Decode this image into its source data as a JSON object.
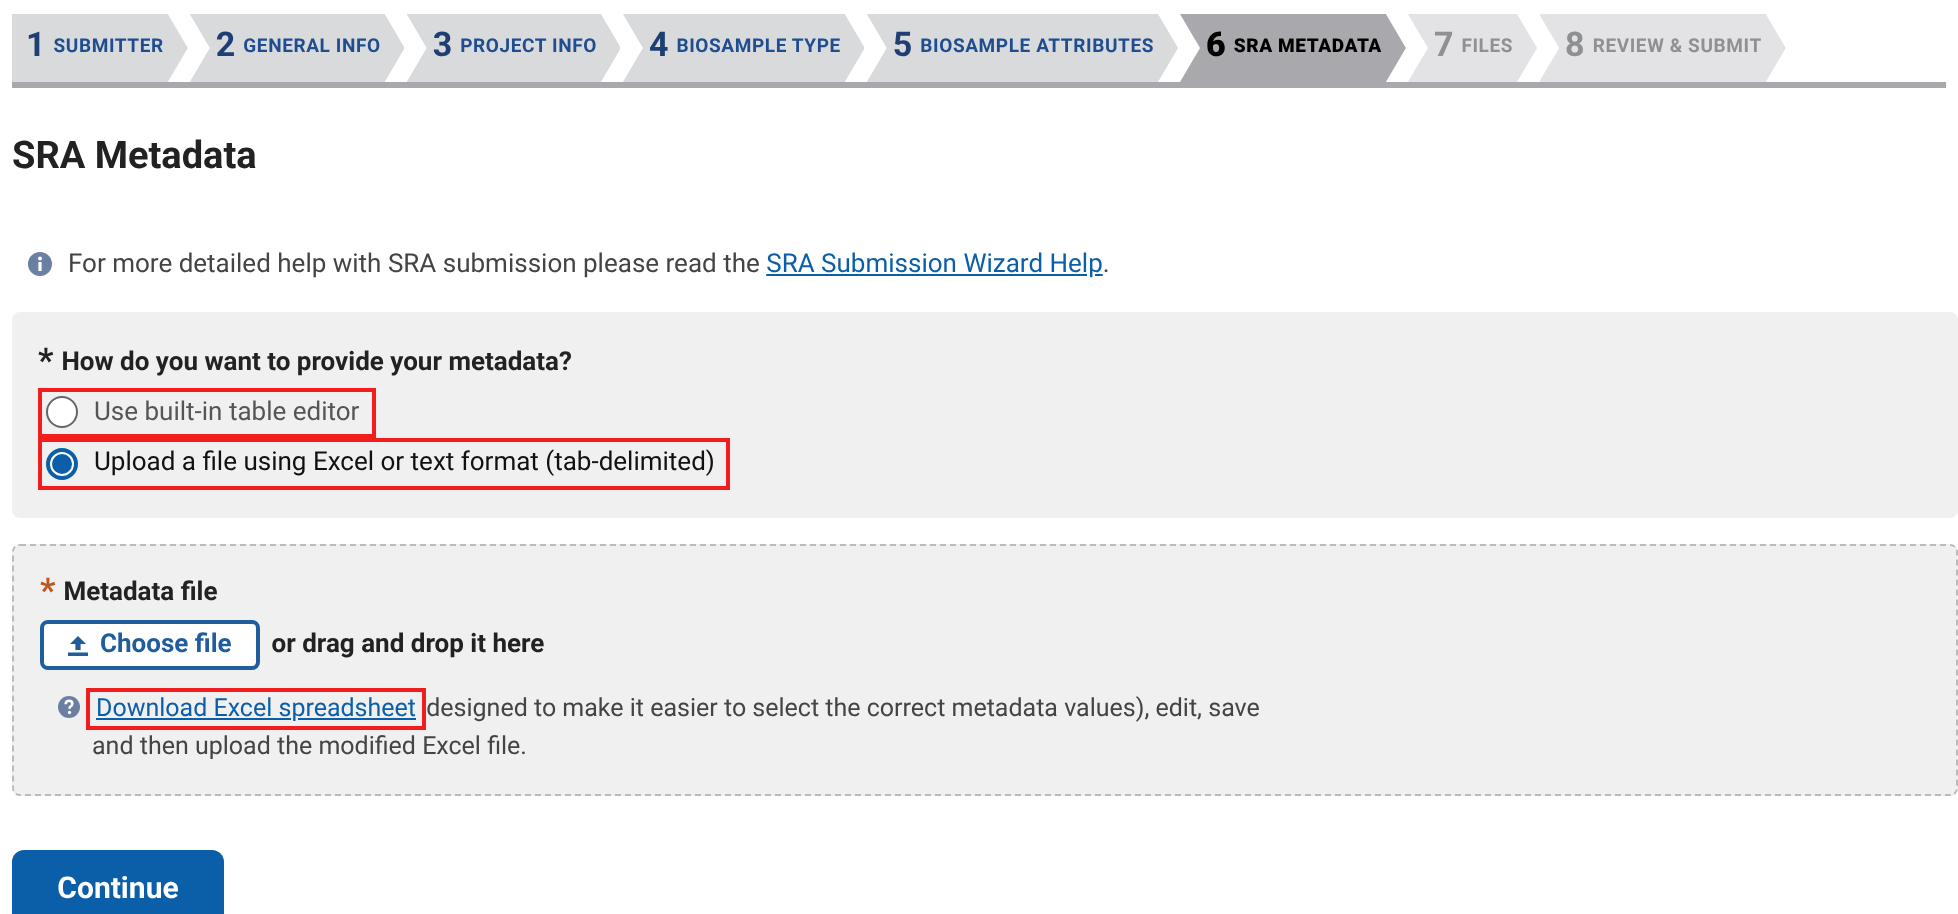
{
  "steps": [
    {
      "number": "1",
      "label": "SUBMITTER",
      "kind": "done",
      "selected": false
    },
    {
      "number": "2",
      "label": "GENERAL INFO",
      "kind": "done",
      "selected": false
    },
    {
      "number": "3",
      "label": "PROJECT INFO",
      "kind": "done",
      "selected": false
    },
    {
      "number": "4",
      "label": "BIOSAMPLE TYPE",
      "kind": "done",
      "selected": false
    },
    {
      "number": "5",
      "label": "BIOSAMPLE ATTRIBUTES",
      "kind": "done",
      "selected": false
    },
    {
      "number": "6",
      "label": "SRA METADATA",
      "kind": "current",
      "selected": true
    },
    {
      "number": "7",
      "label": "FILES",
      "kind": "disabled",
      "selected": false
    },
    {
      "number": "8",
      "label": "REVIEW & SUBMIT",
      "kind": "disabled",
      "selected": false
    }
  ],
  "title": "SRA Metadata",
  "help": {
    "text": "For more detailed help with SRA submission please read the ",
    "link": "SRA Submission Wizard Help",
    "suffix": "."
  },
  "question": {
    "required_mark": "*",
    "label": "How do you want to provide your metadata?",
    "options": [
      {
        "label": "Use built-in table editor",
        "selected": false,
        "highlighted": true
      },
      {
        "label": "Upload a file using Excel or text format (tab-delimited)",
        "selected": true,
        "highlighted": true
      }
    ]
  },
  "metadata_file": {
    "required_mark": "*",
    "label": "Metadata file",
    "button": "Choose file",
    "drop_hint": "or drag and drop it here",
    "note": {
      "link": "Download Excel spreadsheet",
      "link_highlighted": true,
      "text": " designed to make it easier to select the correct metadata values), edit, save and then upload the modified Excel file."
    }
  },
  "continue_button": "Continue"
}
